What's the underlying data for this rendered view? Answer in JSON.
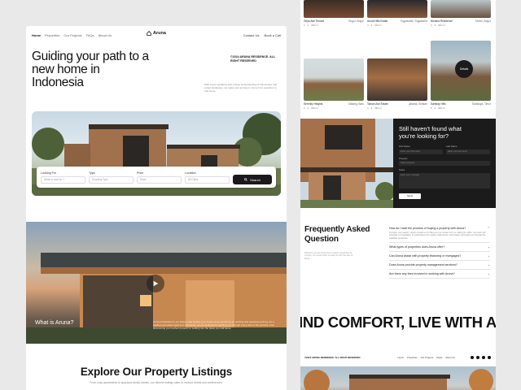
{
  "left": {
    "nav": {
      "links": [
        "Home",
        "Properties",
        "Our Projects",
        "FAQs",
        "About Us"
      ],
      "logo": "Aruna",
      "contact": "Contact Us",
      "book": "Book a Call"
    },
    "hero": {
      "title": "Guiding your path to a new home in Indonesia",
      "copyright": "©2024 ARUNA RESIDENCE. ALL RIGHT RESERVED",
      "description": "With expert guidance and a deep understanding of Indonesia's real estate landscape, we make your journey to home from searches to real home."
    },
    "search": {
      "fields": [
        {
          "label": "Looking For",
          "placeholder": "What to look for ?"
        },
        {
          "label": "Type",
          "placeholder": "Property Type"
        },
        {
          "label": "Price",
          "placeholder": "Price"
        },
        {
          "label": "Location",
          "placeholder": "All Cities"
        }
      ],
      "button": "Search"
    },
    "video": {
      "title": "What is Aruna?",
      "description": "At Aruna Residence, we believe that finding your dream home should be an exciting and seamless journey. As a leading real estate agency in Indonesia, we are dedicated to guiding you through every step of the process, from discovering your perfect property to settling into the place you call home."
    },
    "explore": {
      "title": "Explore Our Property Listings",
      "subtitle": "From cozy apartments to spacious family homes, our diverse listings cater to various needs and preferences."
    }
  },
  "right": {
    "row1": [
      {
        "name": "Griya Asri Terrace",
        "location": "Bogor, Bogor",
        "meta": [
          "3",
          "2",
          "180 m²"
        ]
      },
      {
        "name": "Aruna Hills Estate",
        "location": "Yogyakarta, Yogyakarta",
        "meta": [
          "4",
          "3",
          "240 m²"
        ]
      },
      {
        "name": "Nirvana Residence",
        "location": "Sentul, Bogor",
        "meta": [
          "3",
          "3",
          "200 m²"
        ]
      }
    ],
    "row2": [
      {
        "name": "Serenity Heights",
        "location": "Malang, Batu",
        "meta": [
          "3",
          "2",
          "150 m²"
        ]
      },
      {
        "name": "Taman Asri Estate",
        "location": "Jakarta, Selatan",
        "meta": [
          "4",
          "3",
          "250 m²"
        ]
      },
      {
        "name": "Sambay Hills",
        "location": "Surabaya, Timur",
        "meta": [
          "5",
          "4",
          "300 m²"
        ],
        "badge": "Details"
      }
    ],
    "contact": {
      "title": "Still haven't found what you're looking for?",
      "first_name": "First Name",
      "first_name_ph": "Enter your first name",
      "last_name": "Last Name",
      "last_name_ph": "Enter your last name",
      "property": "Property",
      "property_ph": "Select property",
      "notes": "Notes",
      "notes_ph": "Enter your message",
      "send": "Send"
    },
    "faq": {
      "title": "Frequently Asked Question",
      "note": "Whether you are buying for a modern apartment or a home, our expert team is ready to help the way of living.",
      "items": [
        {
          "q": "How do I start the process of buying a property with Aruna?",
          "a": "To begin your search, simply contact us by filling out our contact form or calling our office. Our team will schedule a consultation to understand your needs, preferences, and budget, and guide you through the available properties."
        },
        {
          "q": "What types of properties does Aruna offer?",
          "a": ""
        },
        {
          "q": "Can Aruna assist with property financing or mortgages?",
          "a": ""
        },
        {
          "q": "Does Aruna provide property management services?",
          "a": ""
        },
        {
          "q": "Are there any fees involved in working with Aruna?",
          "a": ""
        }
      ]
    },
    "marquee": "IND COMFORT, LIVE WITH ARUNA",
    "footer": {
      "copyright": "©2024 ARUNA RESIDENCE. ALL RIGHT RESERVED",
      "links": [
        "Home",
        "Properties",
        "Our Projects",
        "FAQs",
        "About Us"
      ]
    }
  }
}
